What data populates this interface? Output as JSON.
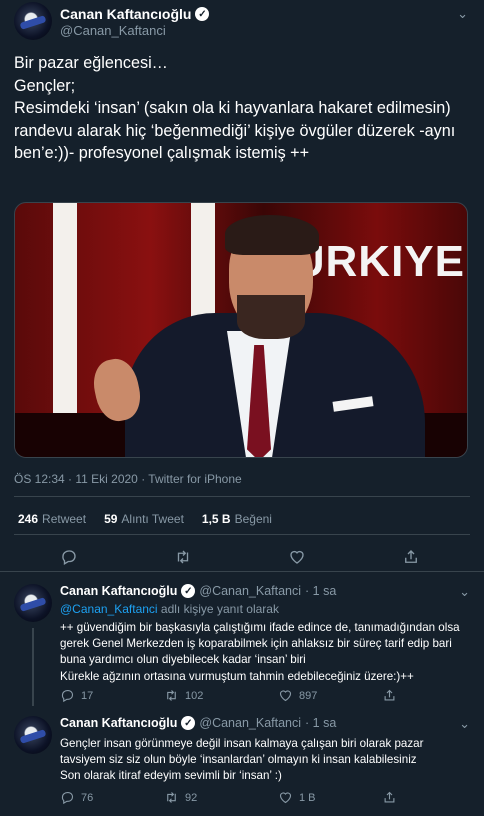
{
  "tweet": {
    "author_name": "Canan Kaftancıoğlu",
    "author_handle": "@Canan_Kaftanci",
    "text": "Bir pazar eğlencesi…\nGençler;\nResimdeki ‘insan’ (sakın ola ki hayvanlara hakaret edilmesin) randevu alarak hiç ‘beğenmediği’ kişiye övgüler düzerek -aynı ben’e:))- profesyonel çalışmak istemiş ++",
    "media_text": "TÜRKIYE",
    "timestamp": "ÖS 12:34 · 11 Eki 2020 · Twitter for iPhone",
    "stats": {
      "retweets_count": "246",
      "retweets_label": "Retweet",
      "quotes_count": "59",
      "quotes_label": "Alıntı Tweet",
      "likes_count": "1,5 B",
      "likes_label": "Beğeni"
    }
  },
  "replies": [
    {
      "author_name": "Canan Kaftancıoğlu",
      "author_handle": "@Canan_Kaftanci",
      "time": "· 1 sa",
      "replying_to_handle": "@Canan_Kaftanci",
      "replying_to_suffix": "adlı kişiye yanıt olarak",
      "text": "++ güvendiğim bir başkasıyla çalıştığımı ifade edince de, tanımadığından olsa gerek Genel Merkezden iş koparabilmek için  ahlaksız bir süreç tarif edip bari buna yardımcı olun diyebilecek kadar ‘insan’ biri\nKürekle ağzının ortasına vurmuştum tahmin edebileceğiniz üzere:)++",
      "reply_count": "17",
      "retweet_count": "102",
      "like_count": "897"
    },
    {
      "author_name": "Canan Kaftancıoğlu",
      "author_handle": "@Canan_Kaftanci",
      "time": "· 1 sa",
      "text": "Gençler insan görünmeye değil insan kalmaya çalışan biri olarak pazar tavsiyem siz siz olun böyle ‘insanlardan’ olmayın ki insan kalabilesiniz\nSon olarak itiraf edeyim sevimli bir ‘insan’ :)",
      "reply_count": "76",
      "retweet_count": "92",
      "like_count": "1 B"
    }
  ]
}
